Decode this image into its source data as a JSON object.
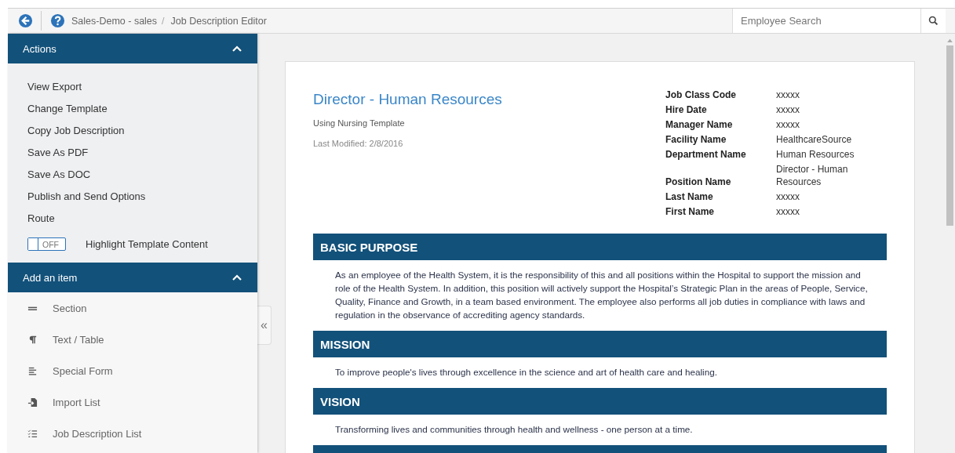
{
  "breadcrumb": [
    "Sales-Demo - sales",
    "Job Description Editor"
  ],
  "breadcrumb_separator": "/",
  "search": {
    "placeholder": "Employee Search"
  },
  "actions": {
    "title": "Actions",
    "expanded": true,
    "items": [
      "View Export",
      "Change Template",
      "Copy Job Description",
      "Save As PDF",
      "Save As DOC",
      "Publish and Send Options",
      "Route"
    ],
    "toggle": {
      "label": "Highlight Template Content",
      "state_text": "OFF",
      "on": false
    }
  },
  "add_item": {
    "title": "Add an item",
    "expanded": true,
    "items": [
      {
        "label": "Section",
        "kind": "section"
      },
      {
        "label": "Text / Table",
        "kind": "text"
      },
      {
        "label": "Special Form",
        "kind": "form"
      },
      {
        "label": "Import List",
        "kind": "import"
      },
      {
        "label": "Job Description List",
        "kind": "list"
      }
    ]
  },
  "collapse": {
    "glyph": "«"
  },
  "document": {
    "title": "Director - Human Resources",
    "template": "Using Nursing Template",
    "modified": "Last Modified: 2/8/2016",
    "fields": [
      {
        "label": "Job Class Code",
        "value": "xxxxx"
      },
      {
        "label": "Hire Date",
        "value": "xxxxx"
      },
      {
        "label": "Manager Name",
        "value": "xxxxx"
      },
      {
        "label": "Facility Name",
        "value": "HealthcareSource"
      },
      {
        "label": "Department Name",
        "value": "Human Resources"
      },
      {
        "label": "Position Name",
        "value": "Director - Human Resources"
      },
      {
        "label": "Last Name",
        "value": "xxxxx"
      },
      {
        "label": "First Name",
        "value": "xxxxx"
      }
    ],
    "sections": [
      {
        "heading": "BASIC PURPOSE",
        "body": "As an employee of the Health System, it is the responsibility of this and all positions within the Hospital to support the mission and role of the Health System. In addition, this position will actively support the Hospital’s Strategic Plan in the areas of People, Service, Quality, Finance and Growth, in a team based environment. The employee also performs all job duties in compliance with laws and regulation in the observance of accrediting agency standards."
      },
      {
        "heading": "MISSION",
        "body": "To improve people's lives through excellence in the science and art of health care and healing."
      },
      {
        "heading": "VISION",
        "body": "Transforming lives and communities through health and wellness - one person at a time."
      }
    ]
  }
}
